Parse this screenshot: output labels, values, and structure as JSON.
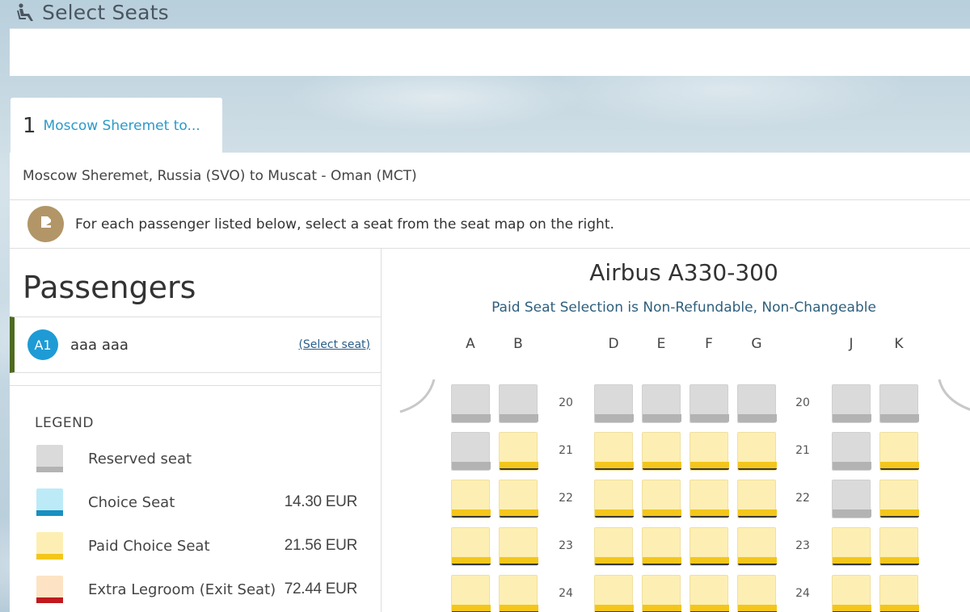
{
  "header": {
    "title": "Select Seats",
    "icon": "seat-icon"
  },
  "tab": {
    "number": "1",
    "label": "Moscow Sheremet to..."
  },
  "route": "Moscow Sheremet, Russia (SVO) to Muscat - Oman (MCT)",
  "instruction": "For each passenger listed below, select a seat from the seat map on the right.",
  "passengers": {
    "heading": "Passengers",
    "items": [
      {
        "code": "A1",
        "name": "aaa aaa",
        "action": "(Select seat)"
      }
    ]
  },
  "legend": {
    "title": "LEGEND",
    "items": [
      {
        "label": "Reserved seat",
        "price": "",
        "top_color": "#dadada",
        "base_color": "#b3b3b3"
      },
      {
        "label": "Choice Seat",
        "price": "14.30 EUR",
        "top_color": "#bdeaf7",
        "base_color": "#1a8fc0"
      },
      {
        "label": "Paid Choice Seat",
        "price": "21.56 EUR",
        "top_color": "#fdefb3",
        "base_color": "#f4c61b"
      },
      {
        "label": "Extra Legroom (Exit Seat)",
        "price": "72.44 EUR",
        "top_color": "#fde3c3",
        "base_color": "#c0191e"
      }
    ]
  },
  "seatmap": {
    "aircraft": "Airbus A330-300",
    "notice": "Paid Seat Selection is Non-Refundable, Non-Changeable",
    "columns": [
      "A",
      "B",
      "D",
      "E",
      "F",
      "G",
      "J",
      "K"
    ],
    "rows": [
      {
        "number": "20",
        "seats": [
          "reserved",
          "reserved",
          "reserved",
          "reserved",
          "reserved",
          "reserved",
          "reserved",
          "reserved"
        ]
      },
      {
        "number": "21",
        "seats": [
          "reserved",
          "paid",
          "paid",
          "paid",
          "paid",
          "paid",
          "reserved",
          "paid"
        ]
      },
      {
        "number": "22",
        "seats": [
          "paid",
          "paid",
          "paid",
          "paid",
          "paid",
          "paid",
          "reserved",
          "paid"
        ]
      },
      {
        "number": "23",
        "seats": [
          "paid",
          "paid",
          "paid",
          "paid",
          "paid",
          "paid",
          "paid",
          "paid"
        ]
      },
      {
        "number": "24",
        "seats": [
          "paid",
          "paid",
          "paid",
          "paid",
          "paid",
          "paid",
          "paid",
          "paid"
        ]
      }
    ]
  }
}
